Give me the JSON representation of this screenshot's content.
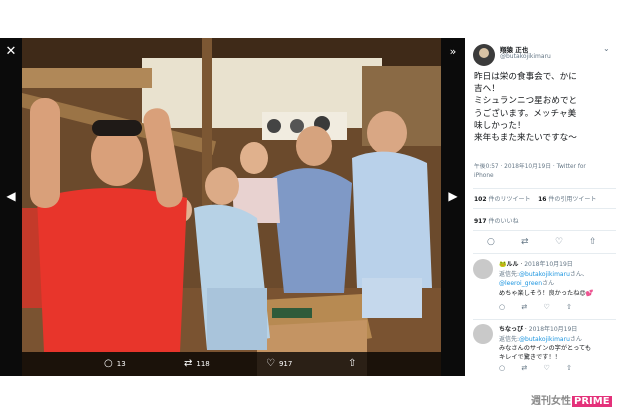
{
  "viewer": {
    "close_icon": "close-icon",
    "expand_icon": "expand-icon",
    "prev_icon": "chevron-left-icon",
    "next_icon": "chevron-right-icon"
  },
  "photo_actions": [
    {
      "icon": "reply-icon",
      "count": "13"
    },
    {
      "icon": "retweet-icon",
      "count": "118"
    },
    {
      "icon": "like-icon",
      "count": "917"
    },
    {
      "icon": "share-icon",
      "count": ""
    }
  ],
  "tweet": {
    "display_name": "翔猿 正也",
    "handle": "@butakojikimaru",
    "text": "昨日は栄の食事会で、かに\n吉へ！\nミシュランニつ星おめでと\nうございます。メッチャ美\n味しかった！\n来年もまた来たいですな〜",
    "timestamp": "午後0:57 · 2018年10月19日 · Twitter for\niPhone",
    "retweets_count": "102",
    "retweets_label": "件のリツイート",
    "quotes_count": "16",
    "quotes_label": "件の引用ツイート",
    "likes_count": "917",
    "likes_label": "件のいいね"
  },
  "replies": [
    {
      "name": "ルル",
      "emoji": "🐸",
      "date": "2018年10月19日",
      "reply_to_prefix": "返信先:",
      "reply_to": "@butakojikimaru",
      "reply_to_suffix": "さん、",
      "line2": "@leeroi_green",
      "line2_suffix": "さん",
      "text": "めちゃ楽しそう！良かったね😍💕"
    },
    {
      "name": "ちなっぴ",
      "emoji": "",
      "date": "2018年10月19日",
      "reply_to_prefix": "返信先:",
      "reply_to": "@butakojikimaru",
      "reply_to_suffix": "さん",
      "text": "みなさんのサインの字がとっても",
      "text2": "キレイで驚きです！！"
    }
  ],
  "watermark": {
    "part1": "週刊女性",
    "part2": "PRIME"
  },
  "colors": {
    "accent_blue": "#1b95e0",
    "watermark_pink": "#e4317a"
  }
}
